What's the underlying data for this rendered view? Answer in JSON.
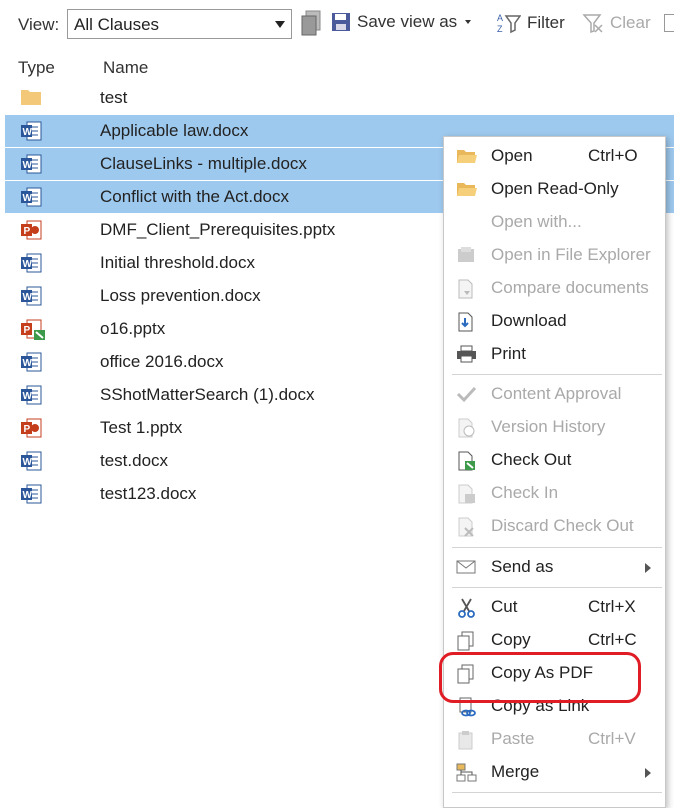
{
  "toolbar": {
    "view_label": "View:",
    "view_value": "All Clauses",
    "save_view": "Save view as",
    "filter": "Filter",
    "clear": "Clear"
  },
  "columns": {
    "type": "Type",
    "name": "Name"
  },
  "files": [
    {
      "name": "test",
      "icon": "folder-icon",
      "selected": false
    },
    {
      "name": "Applicable law.docx",
      "icon": "word-icon",
      "selected": true
    },
    {
      "name": "ClauseLinks - multiple.docx",
      "icon": "word-icon",
      "selected": true
    },
    {
      "name": "Conflict with the Act.docx",
      "icon": "word-icon",
      "selected": true
    },
    {
      "name": "DMF_Client_Prerequisites.pptx",
      "icon": "powerpoint-icon",
      "selected": false
    },
    {
      "name": "Initial threshold.docx",
      "icon": "word-icon",
      "selected": false
    },
    {
      "name": "Loss prevention.docx",
      "icon": "word-icon",
      "selected": false
    },
    {
      "name": "o16.pptx",
      "icon": "powerpoint-checked-out-icon",
      "selected": false
    },
    {
      "name": "office 2016.docx",
      "icon": "word-icon",
      "selected": false
    },
    {
      "name": "SShotMatterSearch (1).docx",
      "icon": "word-icon",
      "selected": false
    },
    {
      "name": "Test 1.pptx",
      "icon": "powerpoint-icon",
      "selected": false
    },
    {
      "name": "test.docx",
      "icon": "word-icon",
      "selected": false
    },
    {
      "name": "test123.docx",
      "icon": "word-icon",
      "selected": false
    }
  ],
  "menu": {
    "open": {
      "label": "Open",
      "shortcut": "Ctrl+O"
    },
    "open_read_only": {
      "label": "Open Read-Only"
    },
    "open_with": {
      "label": "Open with..."
    },
    "open_explorer": {
      "label": "Open in File Explorer"
    },
    "compare": {
      "label": "Compare documents"
    },
    "download": {
      "label": "Download"
    },
    "print": {
      "label": "Print"
    },
    "content_approval": {
      "label": "Content Approval"
    },
    "version_history": {
      "label": "Version History"
    },
    "check_out": {
      "label": "Check Out"
    },
    "check_in": {
      "label": "Check In"
    },
    "discard_check_out": {
      "label": "Discard Check Out"
    },
    "send_as": {
      "label": "Send as"
    },
    "cut": {
      "label": "Cut",
      "shortcut": "Ctrl+X"
    },
    "copy": {
      "label": "Copy",
      "shortcut": "Ctrl+C"
    },
    "copy_as_pdf": {
      "label": "Copy As PDF"
    },
    "copy_as_link": {
      "label": "Copy as Link"
    },
    "paste": {
      "label": "Paste",
      "shortcut": "Ctrl+V"
    },
    "merge": {
      "label": "Merge"
    }
  },
  "colors": {
    "selection": "#9ec9ee",
    "highlight_ring": "#e01c24",
    "disabled_text": "#a9a9a9"
  }
}
